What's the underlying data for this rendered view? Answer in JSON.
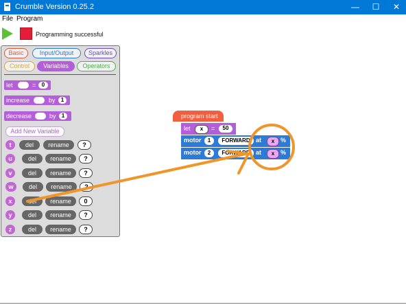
{
  "window": {
    "title": "Crumble Version 0.25.2"
  },
  "menu": [
    "File",
    "Program"
  ],
  "toolbar": {
    "status": "Programming successful"
  },
  "palette": {
    "categories": [
      "Basic",
      "Input/Output",
      "Sparkles",
      "Control",
      "Variables",
      "Operators"
    ],
    "blocks": {
      "let": "let",
      "let_eq": "=",
      "let_val": "0",
      "increase": "increase",
      "by": "by",
      "inc_val": "1",
      "decrease": "decrease",
      "dec_val": "1"
    },
    "add_variable": "Add New Variable",
    "variables": [
      {
        "name": "t",
        "value": "?"
      },
      {
        "name": "u",
        "value": "?"
      },
      {
        "name": "v",
        "value": "?"
      },
      {
        "name": "w",
        "value": "?"
      },
      {
        "name": "x",
        "value": "0"
      },
      {
        "name": "y",
        "value": "?"
      },
      {
        "name": "z",
        "value": "?"
      }
    ],
    "del_label": "del",
    "rename_label": "rename"
  },
  "program": {
    "start": "program start",
    "let": "let",
    "let_var": "x",
    "let_eq": "=",
    "let_val": "50",
    "motor": "motor",
    "forward": "FORWARD",
    "at": "at",
    "percent": "%",
    "motor1_num": "1",
    "motor2_num": "2",
    "var": "x"
  },
  "colors": {
    "titlebar": "#0078d7",
    "variables": "#b45ed9",
    "motor": "#2d7bd6",
    "start": "#f15f3f",
    "annotation": "#f0952a"
  }
}
